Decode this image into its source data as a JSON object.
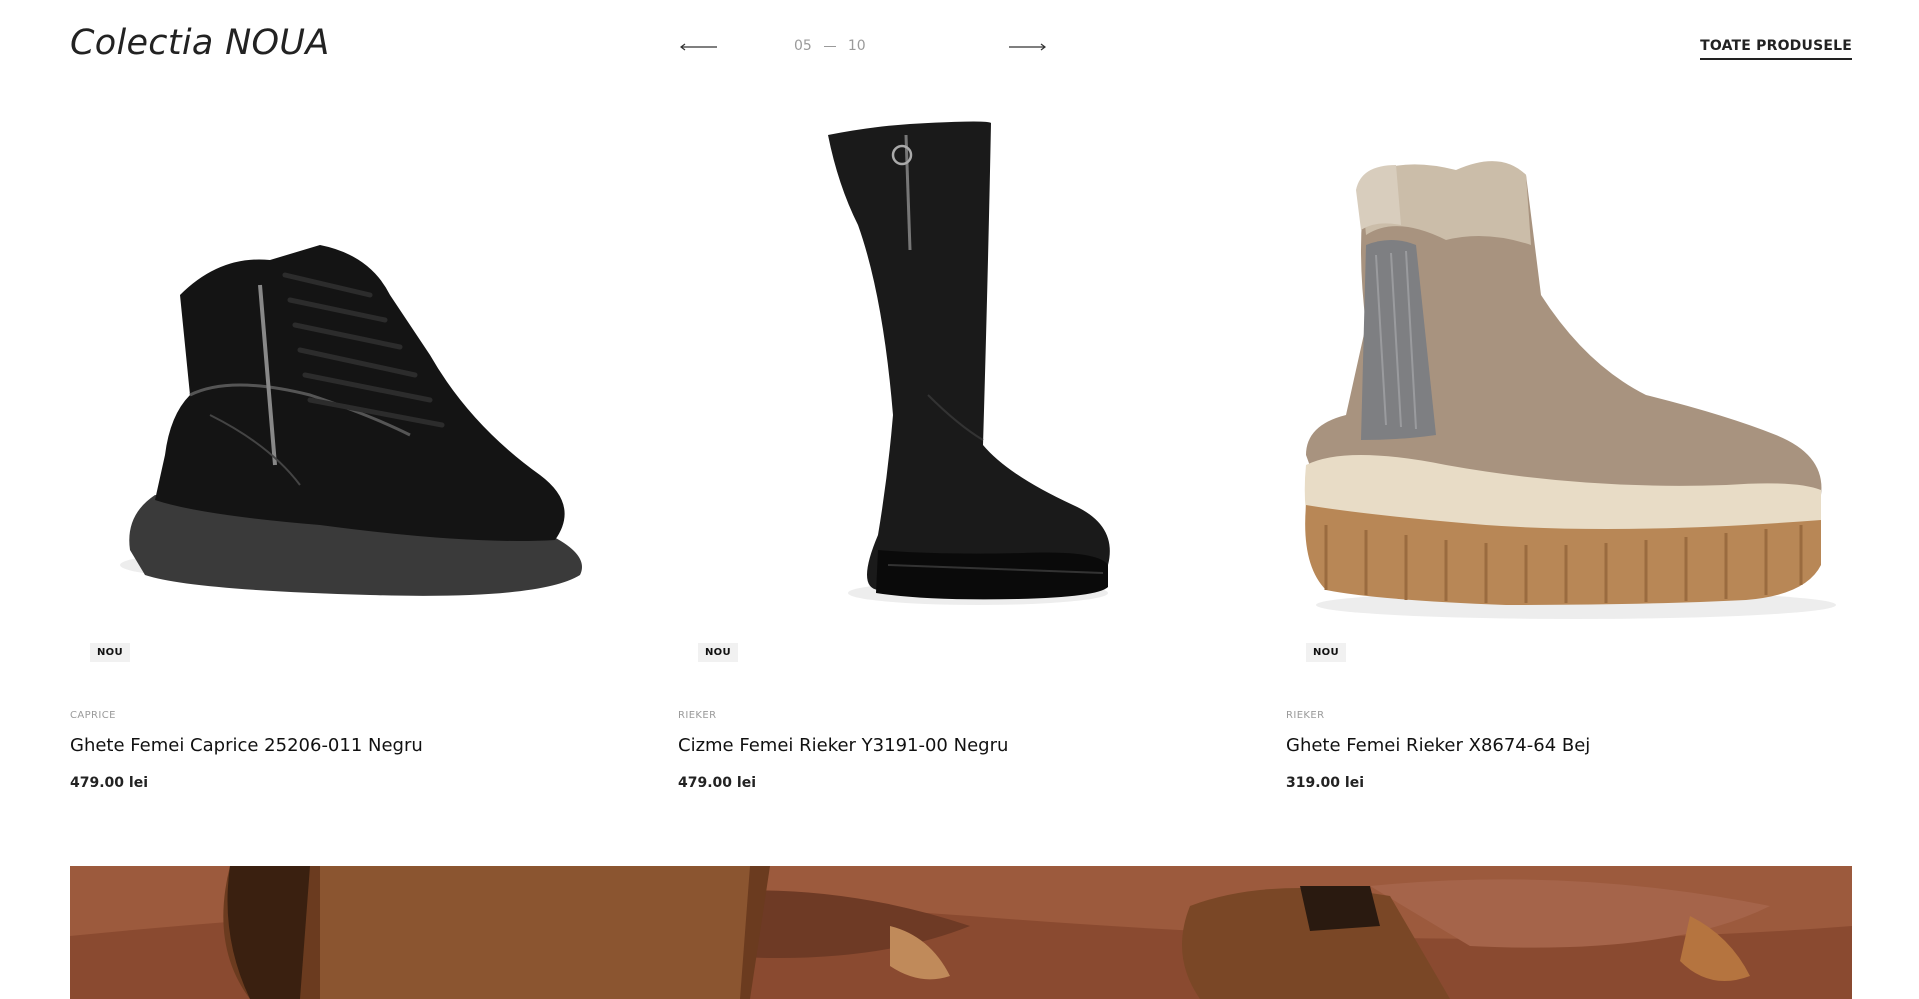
{
  "section": {
    "title": "Colectia NOUA",
    "all_products_label": "TOATE PRODUSELE"
  },
  "pager": {
    "current": "05",
    "total": "10",
    "prev_icon": "arrow-left-icon",
    "next_icon": "arrow-right-icon"
  },
  "products": [
    {
      "badge": "NOU",
      "brand": "CAPRICE",
      "name": "Ghete Femei Caprice 25206-011 Negru",
      "price": "479.00 lei"
    },
    {
      "badge": "NOU",
      "brand": "RIEKER",
      "name": "Cizme Femei Rieker Y3191-00 Negru",
      "price": "479.00 lei"
    },
    {
      "badge": "NOU",
      "brand": "RIEKER",
      "name": "Ghete Femei Rieker X8674-64 Bej",
      "price": "319.00 lei"
    }
  ],
  "colors": {
    "text": "#111111",
    "muted": "#9a9a9a",
    "badge_bg": "#f1f1f1",
    "banner_brown": "#8a4a30"
  }
}
